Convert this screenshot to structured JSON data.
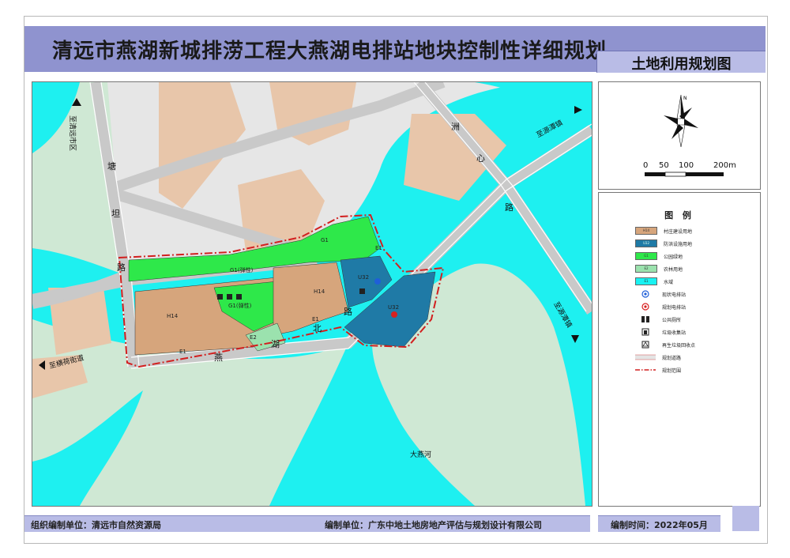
{
  "header": {
    "title": "清远市燕湖新城排涝工程大燕湖电排站地块控制性详细规划",
    "subtitle": "土地利用规划图"
  },
  "map": {
    "road_labels": {
      "tangtan_1": "塘",
      "tangtan_2": "坦",
      "tangtan_3": "路",
      "zhouxin_1": "洲",
      "zhouxin_2": "心",
      "zhouxin_3": "路",
      "yanhubei_1": "燕",
      "yanhubei_2": "湖",
      "yanhubei_3": "北",
      "yanhubei_4": "路"
    },
    "direction_labels": {
      "to_qingyuan": "至清远市区",
      "to_yuantan_ne": "至源潭镇",
      "to_yuantan_se": "至源潭镇",
      "to_henghe": "至横荷街道"
    },
    "river_name": "大燕河",
    "parcels": {
      "g1_north": "G1",
      "g1_elastic": "G1(弹性)",
      "g1_elastic_2": "G1(弹性)",
      "h14_west": "H14",
      "h14_east": "H14",
      "e1_ne": "E1",
      "e1_mid": "E1",
      "e1_sw": "E1",
      "e2": "E2",
      "u32_north": "U32",
      "u32_south": "U32"
    }
  },
  "scale": {
    "ticks": [
      "0",
      "50",
      "100",
      "200m"
    ]
  },
  "legend": {
    "title": "图 例",
    "items": [
      {
        "code": "H14",
        "label": "村庄建设用地",
        "color": "#d6a57c"
      },
      {
        "code": "U32",
        "label": "防洪设施用地",
        "color": "#1f7aa6"
      },
      {
        "code": "G1",
        "label": "公园绿地",
        "color": "#2ee84a"
      },
      {
        "code": "E2",
        "label": "农林用地",
        "color": "#9be2ae"
      },
      {
        "code": "E1",
        "label": "水域",
        "color": "#19f2f2"
      },
      {
        "code": "",
        "label": "现状电排站",
        "icon": "pump-existing-icon"
      },
      {
        "code": "",
        "label": "规划电排站",
        "icon": "pump-planned-icon"
      },
      {
        "code": "",
        "label": "公共厕所",
        "icon": "toilet-icon"
      },
      {
        "code": "",
        "label": "垃圾收集站",
        "icon": "trash-icon"
      },
      {
        "code": "",
        "label": "再生垃圾回收点",
        "icon": "recycle-icon"
      },
      {
        "code": "",
        "label": "规划道路",
        "icon": "road-icon"
      },
      {
        "code": "",
        "label": "规划范围",
        "icon": "boundary-icon"
      }
    ]
  },
  "footer": {
    "organizer": "组织编制单位：清远市自然资源局",
    "compiler": "编制单位：广东中地土地房地产评估与规划设计有限公司",
    "date": "编制时间：2022年05月"
  }
}
